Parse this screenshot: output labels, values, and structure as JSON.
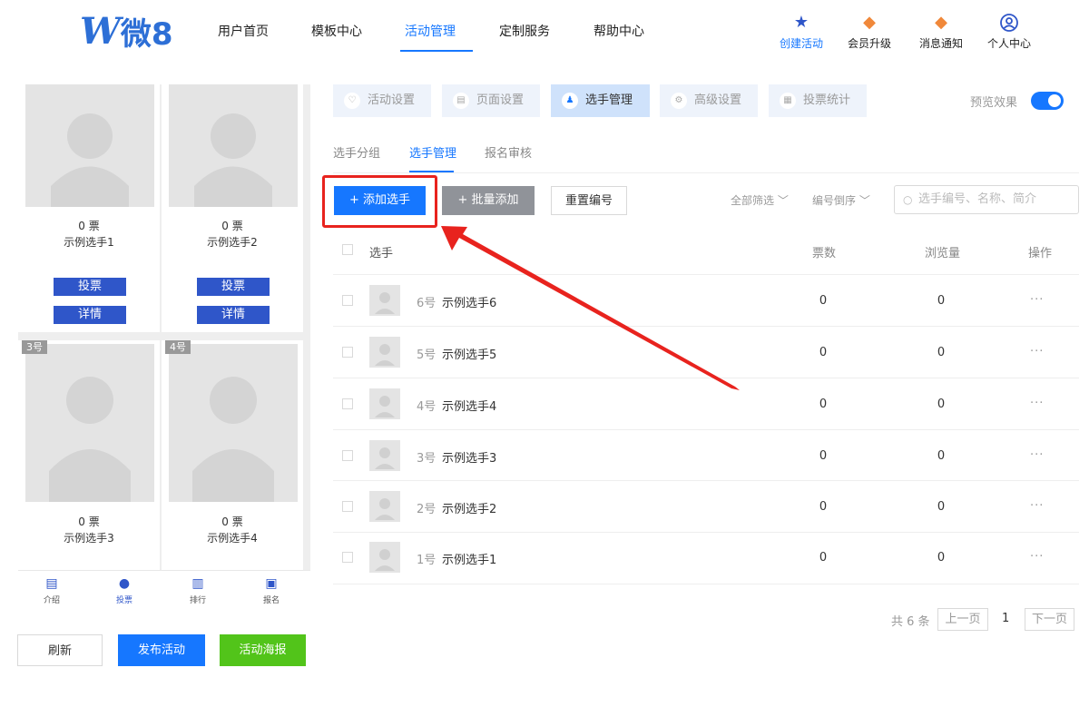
{
  "nav": {
    "logo_w": "W",
    "logo_text": "微8",
    "items": [
      "用户首页",
      "模板中心",
      "活动管理",
      "定制服务",
      "帮助中心"
    ],
    "active_item": "活动管理",
    "icons": [
      {
        "label": "创建活动",
        "icon": "star-icon"
      },
      {
        "label": "会员升级",
        "icon": "member-badge-icon"
      },
      {
        "label": "消息通知",
        "icon": "notification-icon"
      },
      {
        "label": "个人中心",
        "icon": "user-icon"
      }
    ]
  },
  "preview": {
    "cards": [
      {
        "votes": "0 票",
        "name": "示例选手1",
        "vote_label": "投票",
        "detail_label": "详情"
      },
      {
        "votes": "0 票",
        "name": "示例选手2",
        "vote_label": "投票",
        "detail_label": "详情"
      },
      {
        "tag": "3号",
        "votes": "0 票",
        "name": "示例选手3"
      },
      {
        "tag": "4号",
        "votes": "0 票",
        "name": "示例选手4"
      }
    ],
    "tabs": [
      {
        "label": "介绍",
        "icon": "intro-icon"
      },
      {
        "label": "投票",
        "icon": "vote-person-icon"
      },
      {
        "label": "排行",
        "icon": "ranking-icon"
      },
      {
        "label": "报名",
        "icon": "signup-icon"
      }
    ],
    "active_tab": "投票"
  },
  "left_buttons": {
    "refresh": "刷新",
    "publish": "发布活动",
    "poster": "活动海报"
  },
  "main_tabs": [
    {
      "label": "活动设置",
      "icon": "shield-icon"
    },
    {
      "label": "页面设置",
      "icon": "page-icon"
    },
    {
      "label": "选手管理",
      "icon": "contestant-icon"
    },
    {
      "label": "高级设置",
      "icon": "advanced-icon"
    },
    {
      "label": "投票统计",
      "icon": "stats-icon"
    }
  ],
  "active_main_tab": "选手管理",
  "preview_toggle": {
    "label": "预览效果",
    "on": true
  },
  "sub_tabs": [
    "选手分组",
    "选手管理",
    "报名审核"
  ],
  "active_sub_tab": "选手管理",
  "actions": {
    "add": "+ 添加选手",
    "batch": "+ 批量添加",
    "renumber": "重置编号"
  },
  "filters": {
    "all": "全部筛选 ﹀",
    "order": "编号倒序 ﹀"
  },
  "search": {
    "placeholder": "选手编号、名称、简介"
  },
  "table": {
    "headers": {
      "player": "选手",
      "votes": "票数",
      "views": "浏览量",
      "actions": "操作"
    },
    "rows": [
      {
        "num": "6号",
        "name": "示例选手6",
        "votes": "0",
        "views": "0",
        "more": "···"
      },
      {
        "num": "5号",
        "name": "示例选手5",
        "votes": "0",
        "views": "0",
        "more": "···"
      },
      {
        "num": "4号",
        "name": "示例选手4",
        "votes": "0",
        "views": "0",
        "more": "···"
      },
      {
        "num": "3号",
        "name": "示例选手3",
        "votes": "0",
        "views": "0",
        "more": "···"
      },
      {
        "num": "2号",
        "name": "示例选手2",
        "votes": "0",
        "views": "0",
        "more": "···"
      },
      {
        "num": "1号",
        "name": "示例选手1",
        "votes": "0",
        "views": "0",
        "more": "···"
      }
    ]
  },
  "pagination": {
    "total": "共 6 条",
    "prev": "上一页",
    "current": "1",
    "next": "下一页"
  },
  "colors": {
    "primary": "#1677ff",
    "highlight": "#e8231e",
    "success": "#52c41a",
    "vote_button": "#2f56c9"
  }
}
